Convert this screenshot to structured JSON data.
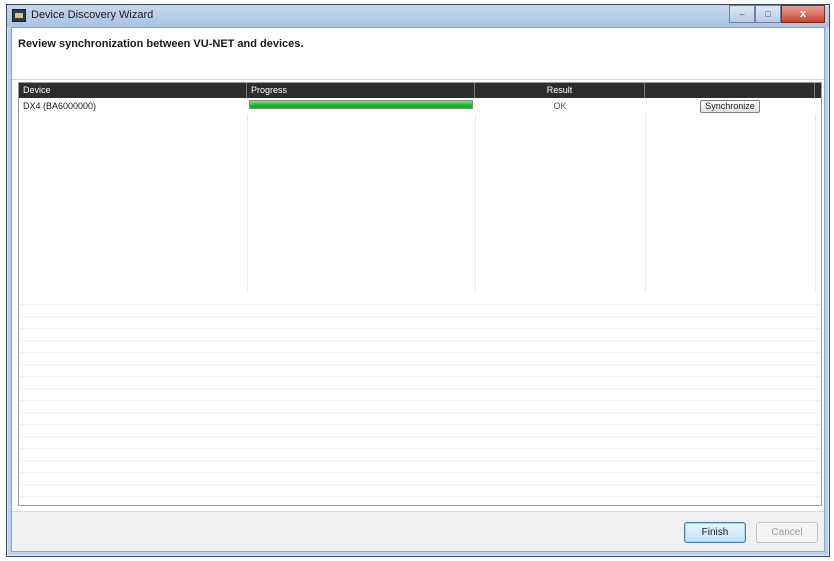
{
  "window": {
    "title": "Device Discovery Wizard",
    "controls": {
      "minimize": "–",
      "maximize": "□",
      "close": "x"
    }
  },
  "instruction": "Review synchronization between VU-NET and devices.",
  "table": {
    "columns": {
      "device": "Device",
      "progress": "Progress",
      "result": "Result",
      "action": ""
    },
    "rows": [
      {
        "device": "DX4  (BA6000000)",
        "progress_percent": 100,
        "result": "OK",
        "action_label": "Synchronize"
      }
    ]
  },
  "footer": {
    "finish_label": "Finish",
    "cancel_label": "Cancel"
  },
  "colors": {
    "titlebar": "#b9d1ea",
    "table_header": "#2d2d2d",
    "progress_fill": "#16c02a",
    "close_button": "#c9452e"
  },
  "icons": {
    "app": "device-wizard-icon"
  }
}
